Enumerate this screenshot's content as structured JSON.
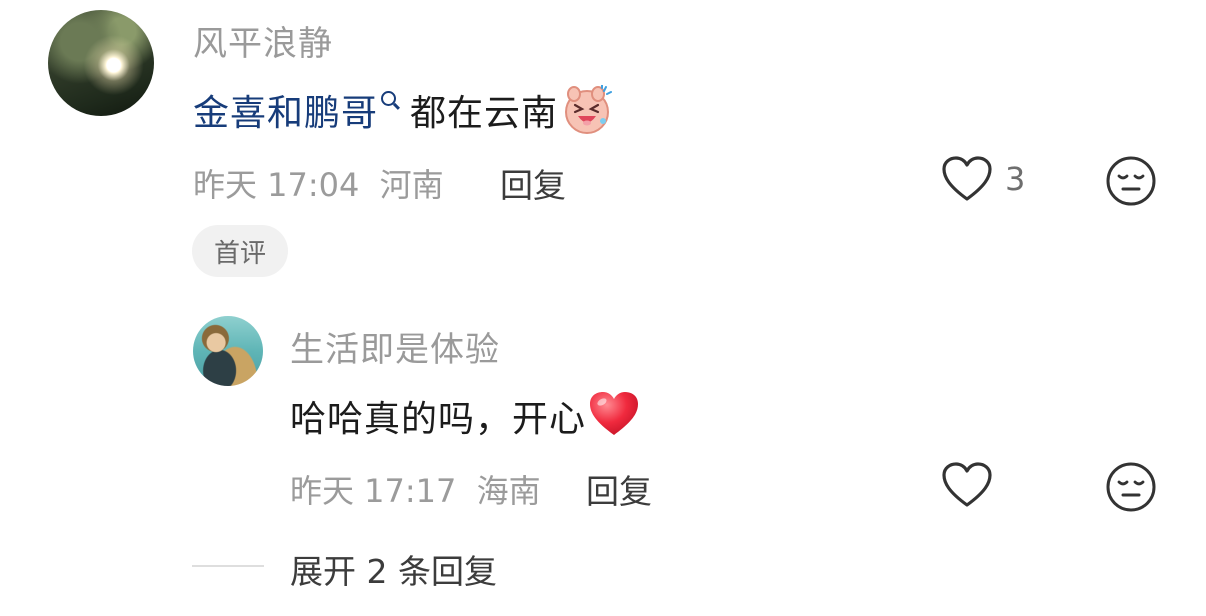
{
  "comment": {
    "username": "风平浪静",
    "mention": "金喜和鹏哥",
    "text": "都在云南",
    "emoji": "laughing-pig-emoji",
    "time": "昨天 17:04",
    "location": "河南",
    "reply_label": "回复",
    "like_count": "3",
    "badge": "首评"
  },
  "reply": {
    "username": "生活即是体验",
    "text": "哈哈真的吗，开心",
    "emoji": "red-heart-emoji",
    "time": "昨天 17:17",
    "location": "海南",
    "reply_label": "回复"
  },
  "expand_replies": "展开 2 条回复",
  "colors": {
    "mention": "#173c7a",
    "meta": "#9b9b9b",
    "username": "#9a9a9a",
    "badge_bg": "#f1f1f1"
  }
}
